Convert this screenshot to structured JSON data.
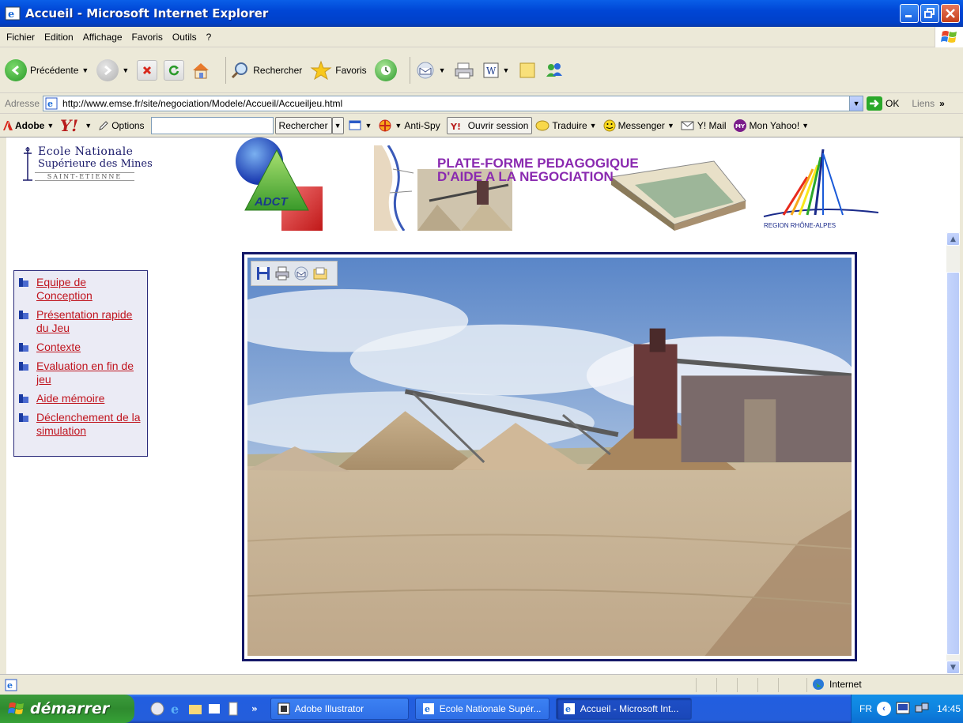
{
  "window": {
    "title": "Accueil - Microsoft Internet Explorer"
  },
  "menu": [
    "Fichier",
    "Edition",
    "Affichage",
    "Favoris",
    "Outils",
    "?"
  ],
  "toolbar": {
    "back_label": "Précédente",
    "search_label": "Rechercher",
    "favorites_label": "Favoris"
  },
  "address": {
    "label": "Adresse",
    "url": "http://www.emse.fr/site/negociation/Modele/Accueil/Accueiljeu.html",
    "go_label": "OK",
    "links_label": "Liens"
  },
  "yahoo_bar": {
    "adobe_label": "Adobe",
    "options_label": "Options",
    "search_button": "Rechercher",
    "antispy_label": "Anti-Spy",
    "session_label": "Ouvrir session",
    "translate_label": "Traduire",
    "messenger_label": "Messenger",
    "mail_label": "Y! Mail",
    "myyahoo_label": "Mon Yahoo!"
  },
  "page": {
    "school_line1": "Ecole Nationale",
    "school_line2": "Supérieure des Mines",
    "school_line3": "SAINT-ETIENNE",
    "adct_label": "ADCT",
    "banner_line1": "PLATE-FORME PEDAGOGIQUE",
    "banner_line2": "D'AIDE A LA NEGOCIATION",
    "region_label": "REGION RHÔNE-ALPES",
    "nav": [
      {
        "label": "Equipe de Conception"
      },
      {
        "label": "Présentation rapide du Jeu"
      },
      {
        "label": "Contexte"
      },
      {
        "label": "Evaluation en fin de jeu"
      },
      {
        "label": "Aide mémoire"
      },
      {
        "label": "Déclenchement de la simulation"
      }
    ]
  },
  "status": {
    "zone": "Internet"
  },
  "taskbar": {
    "start_label": "démarrer",
    "tasks": [
      {
        "label": "Adobe Illustrator"
      },
      {
        "label": "Ecole Nationale Supér..."
      },
      {
        "label": "Accueil - Microsoft Int..."
      }
    ],
    "lang": "FR",
    "clock": "14:45"
  },
  "colors": {
    "link": "#c0141e",
    "frame": "#141868",
    "titlebar": "#0046d5"
  }
}
